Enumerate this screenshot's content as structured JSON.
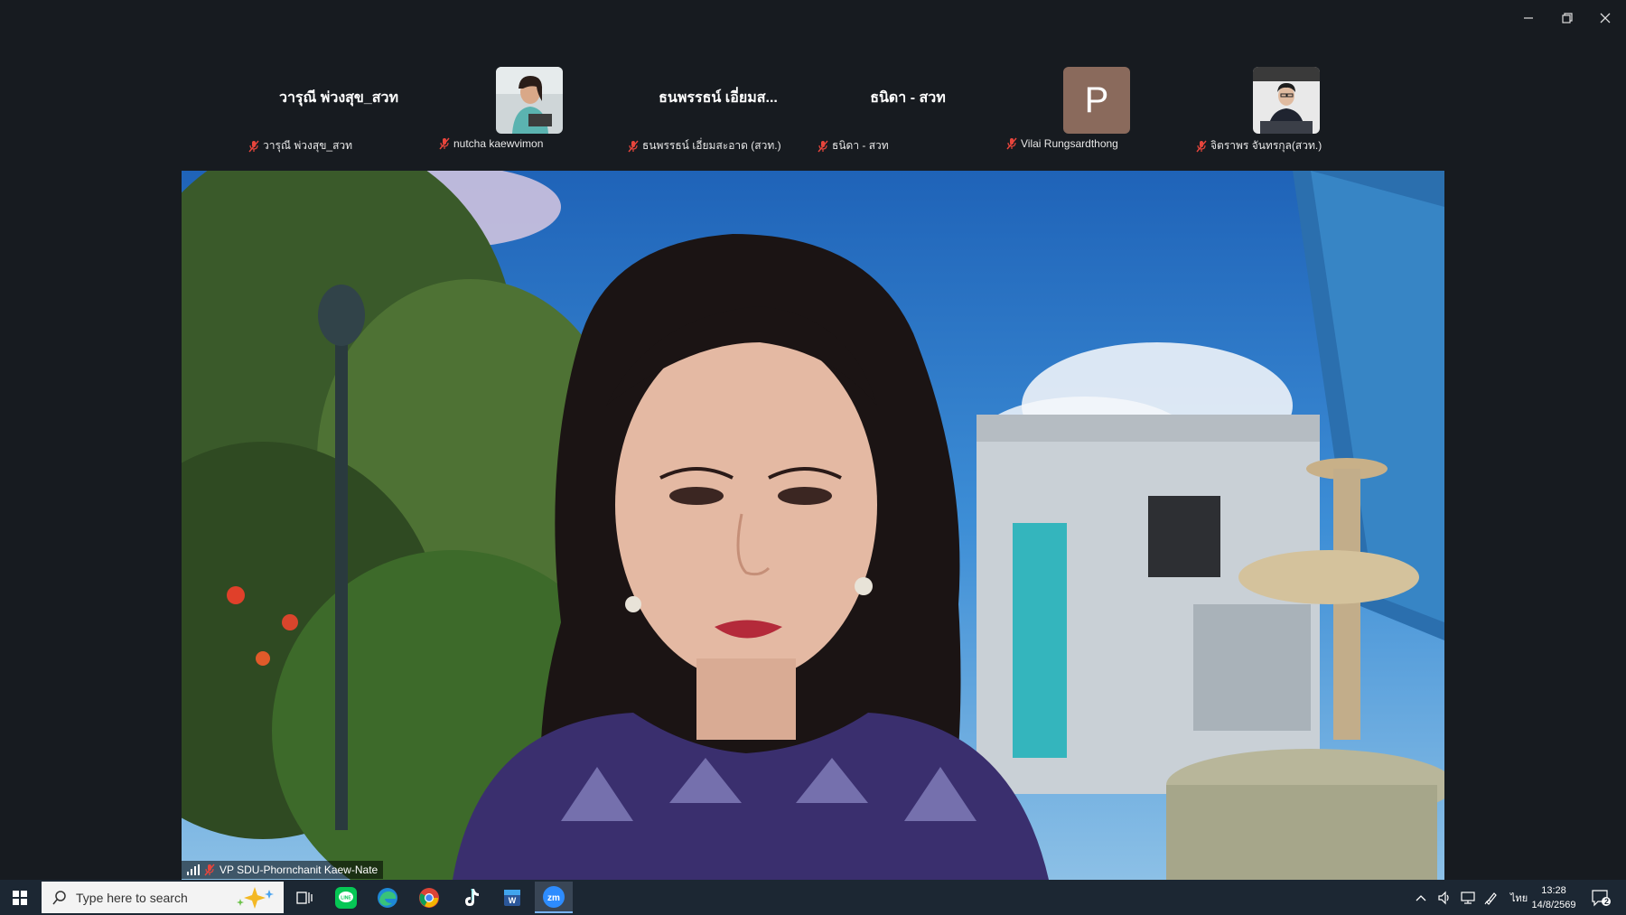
{
  "window": {
    "minimize_icon": "minimize-icon",
    "restore_icon": "restore-icon",
    "close_icon": "close-icon"
  },
  "participants": [
    {
      "big_name": "วารุณี พ่วงสุข_สวท",
      "label": "วารุณี พ่วงสุข_สวท",
      "type": "name"
    },
    {
      "big_name": "",
      "label": "nutcha kaewvimon",
      "type": "photo"
    },
    {
      "big_name": "ธนพรรธน์ เอี่ยมส...",
      "label": "ธนพรรธน์ เอี่ยมสะอาด (สวท.)",
      "type": "name"
    },
    {
      "big_name": "ธนิดา - สวท",
      "label": "ธนิดา - สวท",
      "type": "name"
    },
    {
      "big_name": "P",
      "label": "Vilai Rungsardthong",
      "type": "letter"
    },
    {
      "big_name": "",
      "label": "จิตราพร จันทรกุล(สวท.)",
      "type": "photo"
    }
  ],
  "speaker": {
    "name": "VP SDU-Phornchanit Kaew-Nate"
  },
  "taskbar": {
    "search_placeholder": "Type here to search",
    "apps": [
      "task-view-icon",
      "line-app-icon",
      "edge-icon",
      "chrome-icon",
      "tiktok-icon",
      "word-icon",
      "zoom-icon"
    ],
    "language": "ไทย",
    "time": "13:28",
    "date": "14/8/2569",
    "notification_count": "2"
  },
  "colors": {
    "background": "#171b20",
    "taskbar": "#1c2733",
    "muted_mic": "#e8453c",
    "avatar_letter_bg": "#8a6a5c"
  }
}
